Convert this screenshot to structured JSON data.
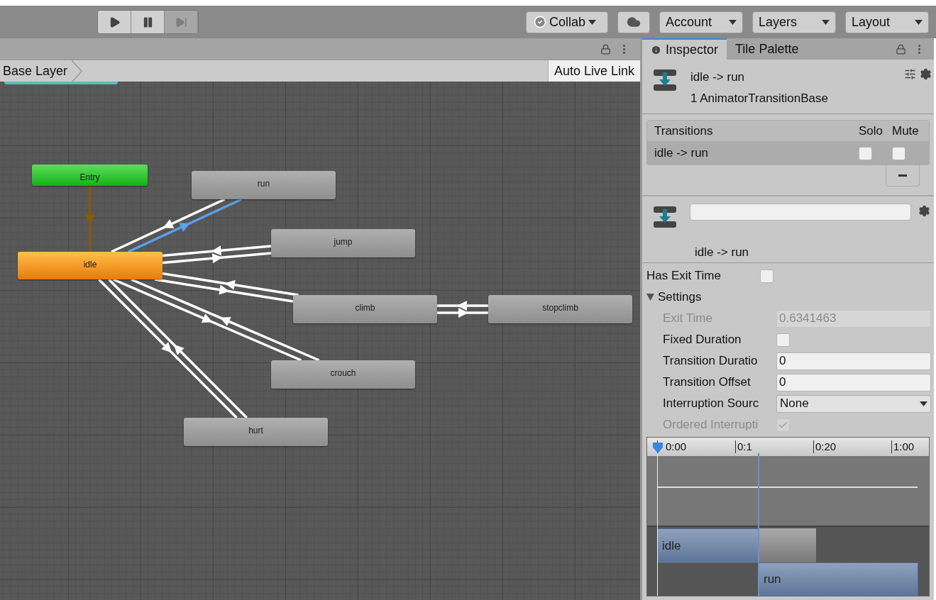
{
  "toolbar": {
    "play_buttons": [
      {
        "kind": "play",
        "disabled": false
      },
      {
        "kind": "pause",
        "disabled": false
      },
      {
        "kind": "step",
        "disabled": true
      }
    ],
    "collab": "Collab",
    "dropdowns": [
      "Account",
      "Layers",
      "Layout"
    ]
  },
  "animator": {
    "breadcrumb": "Base Layer",
    "auto_live_link": "Auto Live Link",
    "states": [
      {
        "name": "Entry",
        "kind": "entry"
      },
      {
        "name": "run",
        "kind": "state"
      },
      {
        "name": "idle",
        "kind": "default"
      },
      {
        "name": "jump",
        "kind": "state"
      },
      {
        "name": "climb",
        "kind": "state"
      },
      {
        "name": "stopclimb",
        "kind": "state"
      },
      {
        "name": "crouch",
        "kind": "state"
      },
      {
        "name": "hurt",
        "kind": "state"
      }
    ],
    "transitions": [
      {
        "kind": "entry",
        "selected": false
      },
      {
        "kind": "normal",
        "selected": true
      },
      {
        "kind": "normal",
        "selected": false
      },
      {
        "kind": "normal",
        "selected": false
      },
      {
        "kind": "normal",
        "selected": false
      },
      {
        "kind": "normal",
        "selected": false
      },
      {
        "kind": "normal",
        "selected": false
      },
      {
        "kind": "normal",
        "selected": false
      },
      {
        "kind": "normal",
        "selected": false
      },
      {
        "kind": "normal",
        "selected": false
      },
      {
        "kind": "normal",
        "selected": false
      },
      {
        "kind": "normal",
        "selected": false
      },
      {
        "kind": "normal",
        "selected": false
      }
    ]
  },
  "inspector": {
    "tabs": [
      {
        "label": "Inspector",
        "selected": true
      },
      {
        "label": "Tile Palette",
        "selected": false
      }
    ],
    "title": "idle -> run",
    "subtitle": "1 AnimatorTransitionBase",
    "transitions_list": {
      "columns": [
        "Transitions",
        "Solo",
        "Mute"
      ],
      "rows": [
        {
          "name": "idle -> run",
          "solo": false,
          "mute": false
        }
      ]
    },
    "transition_name": "idle -> run",
    "properties": [
      {
        "kind": "checkbox",
        "label": "Has Exit Time",
        "checked": false,
        "disabled": false
      },
      {
        "kind": "foldout",
        "label": "Settings",
        "expanded": true,
        "children": [
          {
            "kind": "field",
            "label": "Exit Time",
            "value": "0.6341463",
            "disabled": true
          },
          {
            "kind": "checkbox",
            "label": "Fixed Duration",
            "checked": false,
            "disabled": false
          },
          {
            "kind": "field",
            "label": "Transition Duratio",
            "value": "0",
            "disabled": false
          },
          {
            "kind": "field",
            "label": "Transition Offset",
            "value": "0",
            "disabled": false
          },
          {
            "kind": "dropdown",
            "label": "Interruption Sourc",
            "value": "None"
          },
          {
            "kind": "checkbox",
            "label": "Ordered Interrupti",
            "checked": true,
            "disabled": true
          }
        ]
      }
    ],
    "timeline": {
      "ticks": [
        "0:00",
        "0:1",
        "0:20",
        "1:00"
      ],
      "clips": [
        "idle",
        "run"
      ]
    }
  }
}
